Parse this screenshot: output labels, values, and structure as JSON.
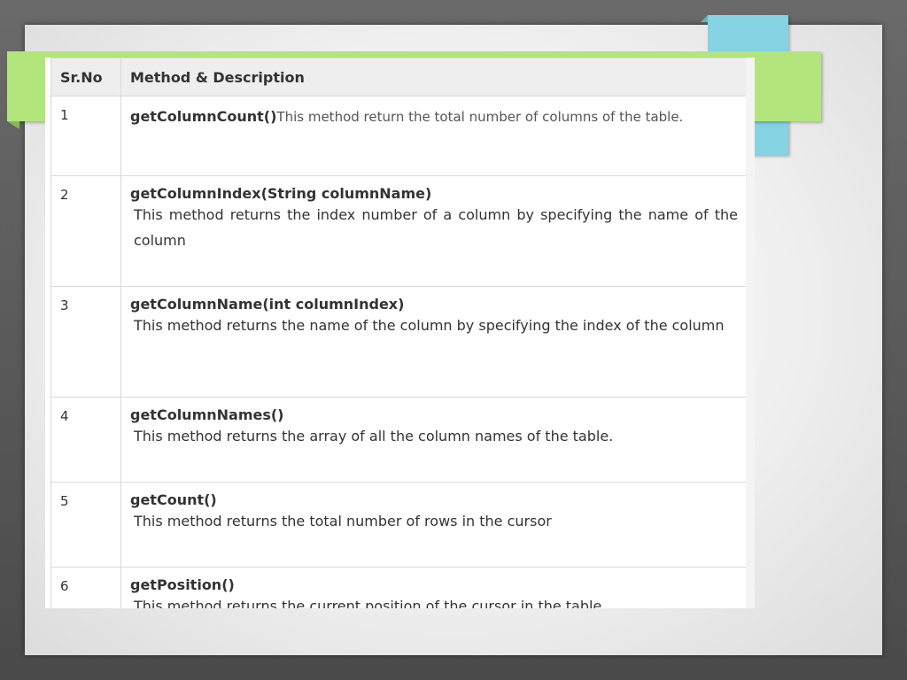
{
  "table": {
    "headers": [
      "Sr.No",
      "Method & Description"
    ],
    "rows": [
      {
        "num": "1",
        "method": "getColumnCount()",
        "description": "This method return the total number of columns of the table."
      },
      {
        "num": "2",
        "method": "getColumnIndex(String columnName)",
        "description": "This method returns the index number of a column by specifying the name of the column"
      },
      {
        "num": "3",
        "method": "getColumnName(int columnIndex)",
        "description": "This method returns the name of the column by specifying the index of the column"
      },
      {
        "num": "4",
        "method": "getColumnNames()",
        "description": "This method returns the array of all the column names of the table."
      },
      {
        "num": "5",
        "method": "getCount()",
        "description": "This method returns the total number of rows in the cursor"
      },
      {
        "num": "6",
        "method": "getPosition()",
        "description": "This method returns the current position of the cursor in the table"
      }
    ]
  },
  "colors": {
    "accent_green": "#b2e57c",
    "accent_blue": "#86d3e3",
    "header_bg": "#eeeeee"
  }
}
